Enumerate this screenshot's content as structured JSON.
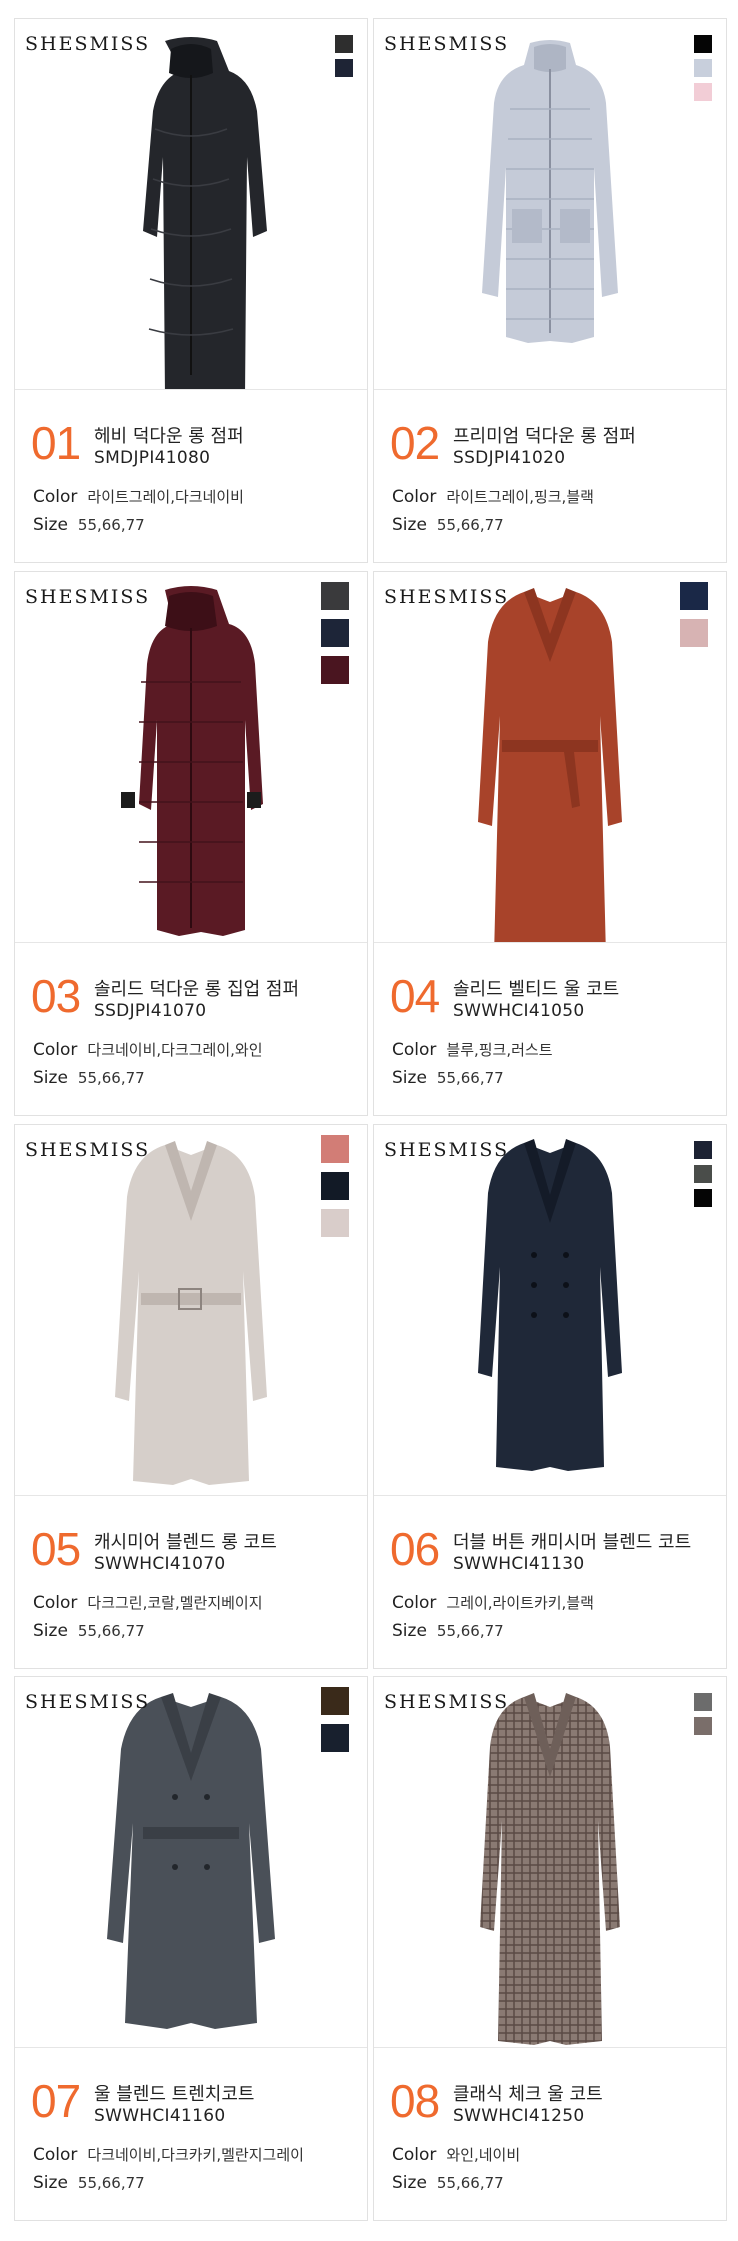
{
  "brand": "SHESMISS",
  "colors": {
    "accent": "#ef6a2e",
    "border": "#e1e1e1"
  },
  "labels": {
    "color": "Color",
    "size": "Size"
  },
  "products": [
    {
      "number": "01",
      "name": "헤비 덕다운 롱 점퍼",
      "code": "SMDJPI41080",
      "colors": "라이트그레이,다크네이비",
      "sizes": "55,66,77",
      "swatches": [
        "#2e2e2e",
        "#1e2435"
      ],
      "coat": "down-dark"
    },
    {
      "number": "02",
      "name": "프리미엄 덕다운 롱 점퍼",
      "code": "SSDJPI41020",
      "colors": "라이트그레이,핑크,블랙",
      "sizes": "55,66,77",
      "swatches": [
        "#050505",
        "#c8cfdc",
        "#f2cdd6"
      ],
      "coat": "down-light"
    },
    {
      "number": "03",
      "name": "솔리드 덕다운 롱 집업 점퍼",
      "code": "SSDJPI41070",
      "colors": "다크네이비,다크그레이,와인",
      "sizes": "55,66,77",
      "swatches": [
        "#3a3a3c",
        "#1d2538",
        "#4a1520"
      ],
      "coat": "down-wine"
    },
    {
      "number": "04",
      "name": "솔리드 벨티드 울 코트",
      "code": "SWWHCI41050",
      "colors": "블루,핑크,러스트",
      "sizes": "55,66,77",
      "swatches": [
        "#1a2847",
        "#d7b3b3"
      ],
      "coat": "wool-rust"
    },
    {
      "number": "05",
      "name": "캐시미어 블렌드 롱 코트",
      "code": "SWWHCI41070",
      "colors": "다크그린,코랄,멜란지베이지",
      "sizes": "55,66,77",
      "swatches": [
        "#d27d76",
        "#121a26",
        "#d9cdca"
      ],
      "coat": "wool-beige"
    },
    {
      "number": "06",
      "name": "더블 버튼 캐미시머 블렌드 코트",
      "code": "SWWHCI41130",
      "colors": "그레이,라이트카키,블랙",
      "sizes": "55,66,77",
      "swatches": [
        "#1c2233",
        "#4a4d4a",
        "#050505"
      ],
      "coat": "wool-navy"
    },
    {
      "number": "07",
      "name": "울 블렌드 트렌치코트",
      "code": "SWWHCI41160",
      "colors": "다크네이비,다크카키,멜란지그레이",
      "sizes": "55,66,77",
      "swatches": [
        "#3a2a1a",
        "#18202e"
      ],
      "coat": "trench-grey"
    },
    {
      "number": "08",
      "name": "클래식 체크 울 코트",
      "code": "SWWHCI41250",
      "colors": "와인,네이비",
      "sizes": "55,66,77",
      "swatches": [
        "#6c6c6c",
        "#7a6e6a"
      ],
      "coat": "check"
    }
  ]
}
